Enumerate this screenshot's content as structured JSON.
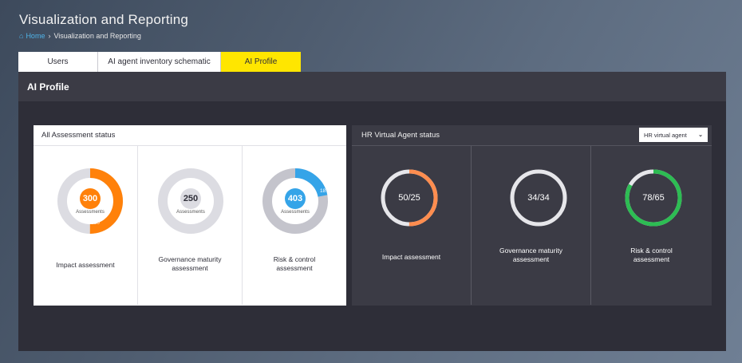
{
  "page": {
    "title": "Visualization and Reporting",
    "breadcrumb": {
      "home": "Home",
      "current": "Visualization and Reporting"
    }
  },
  "tabs": [
    {
      "label": "Users",
      "active": false
    },
    {
      "label": "AI agent inventory schematic",
      "active": false
    },
    {
      "label": "AI Profile",
      "active": true
    }
  ],
  "panel": {
    "title": "AI Profile"
  },
  "all_assessment": {
    "title": "All Assessment status",
    "items": [
      {
        "label": "Impact assessment",
        "value": "300",
        "sub": "Assessments",
        "segment": "150",
        "fraction": 0.5,
        "color": "#ff810a"
      },
      {
        "label": "Governance maturity assessment",
        "value": "250",
        "sub": "Assessments",
        "segment": "",
        "fraction": 0.0,
        "color": "#dcdce2"
      },
      {
        "label": "Risk & control assessment",
        "value": "403",
        "sub": "Assessments",
        "segment": "18",
        "fraction": 0.22,
        "color": "#35a4e8"
      }
    ]
  },
  "hr_agent": {
    "title": "HR Virtual Agent status",
    "dropdown": {
      "selected": "HR virtual agent"
    },
    "items": [
      {
        "label": "Impact assessment",
        "value": "50/25",
        "fraction": 0.5,
        "color": "#ff8d4f"
      },
      {
        "label": "Governance maturity assessment",
        "value": "34/34",
        "fraction": 0.0,
        "color": "#e6e6ea"
      },
      {
        "label": "Risk & control assessment",
        "value": "78/65",
        "fraction": 0.83,
        "color": "#2dbd53"
      }
    ]
  },
  "colors": {
    "accent": "#ffe600",
    "panel": "#2e2e38",
    "link": "#4fb3e8"
  },
  "icons": {
    "home": "home-icon",
    "separator": "chevron-right-icon",
    "dropdown": "chevron-down-icon"
  }
}
